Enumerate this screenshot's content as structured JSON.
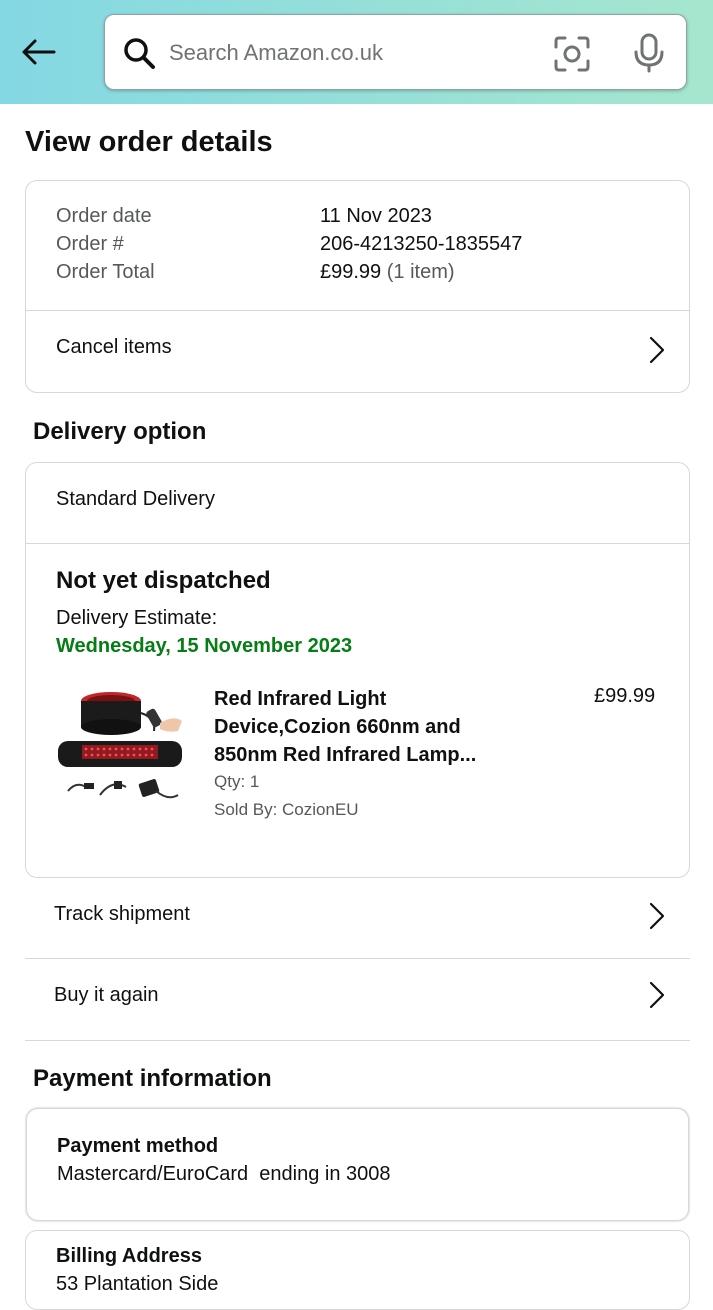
{
  "header": {
    "search_placeholder": "Search Amazon.co.uk",
    "icons": [
      "back-arrow-icon",
      "search-icon",
      "camera-icon",
      "microphone-icon"
    ]
  },
  "page": {
    "title": "View order details"
  },
  "order_summary": {
    "rows": [
      {
        "label": "Order date",
        "value": "11 Nov 2023"
      },
      {
        "label": "Order #",
        "value": "206-4213250-1835547"
      },
      {
        "label": "Order Total",
        "value": "£99.99",
        "note": "(1 item)"
      }
    ],
    "cancel_label": "Cancel items"
  },
  "delivery": {
    "section_title": "Delivery option",
    "option": "Standard Delivery",
    "status": "Not yet dispatched",
    "estimate_label": "Delivery Estimate:",
    "estimate_date": "Wednesday, 15 November 2023",
    "estimate_color": "#067d15",
    "item": {
      "title": "Red Infrared Light Device,Cozion 660nm and 850nm Red Infrared Lamp...",
      "price": "£99.99",
      "qty": "Qty: 1",
      "seller": "Sold By: CozionEU"
    }
  },
  "actions": {
    "track": "Track shipment",
    "buy_again": "Buy it again"
  },
  "payment": {
    "section_title": "Payment information",
    "method_title": "Payment method",
    "method_value": "Mastercard/EuroCard  ending in 3008",
    "billing_title": "Billing Address",
    "billing_line": "53 Plantation Side"
  },
  "colors": {
    "header_gradient_start": "#84d8e3",
    "header_gradient_end": "#a6e6ce",
    "border": "#d5d9d9",
    "text": "#0f1111",
    "muted": "#565959"
  }
}
